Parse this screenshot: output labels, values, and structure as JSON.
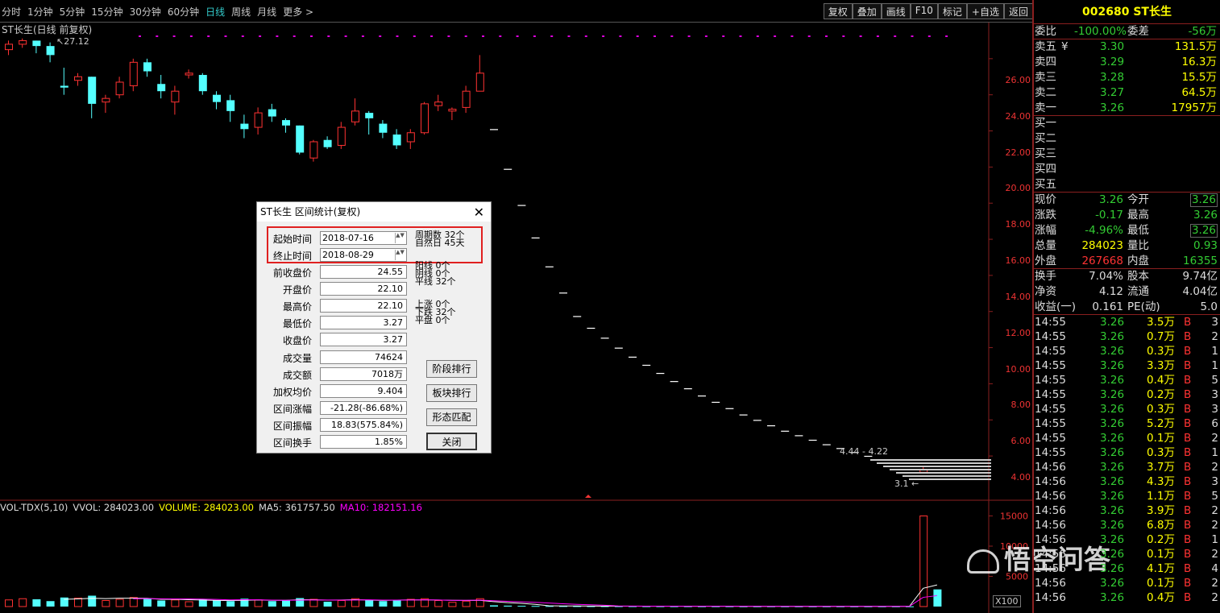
{
  "toolbar": {
    "periods": [
      "分时",
      "1分钟",
      "5分钟",
      "15分钟",
      "30分钟",
      "60分钟",
      "日线",
      "周线",
      "月线",
      "更多 >"
    ],
    "active_period": "日线",
    "tools": [
      "复权",
      "叠加",
      "画线",
      "F10",
      "标记",
      "+自选",
      "返回"
    ]
  },
  "chart": {
    "title": "ST长生(日线 前复权)",
    "peak_label": "27.12",
    "y_labels": [
      "26.00",
      "24.00",
      "22.00",
      "20.00",
      "18.00",
      "16.00",
      "14.00",
      "12.00",
      "10.00",
      "8.00",
      "6.00",
      "4.00"
    ],
    "vol_y_labels": [
      "15000",
      "10000",
      "5000"
    ],
    "range_label": "4.44 - 4.22",
    "low_label": "3.1",
    "x100": "X100",
    "vol_header": {
      "name": "VOL-TDX(5,10)",
      "vvol": "VVOL: 284023.00",
      "volume": "VOLUME: 284023.00",
      "ma5": "MA5: 361757.50",
      "ma10": "MA10: 182151.16"
    },
    "colors": {
      "up": "#ff3232",
      "down": "#54ffff",
      "ma10": "#ff00ff"
    }
  },
  "chart_data": {
    "type": "candlestick",
    "title": "ST长生(日线 前复权)",
    "ylim": [
      2.8,
      28
    ],
    "candles": [
      {
        "o": 26.5,
        "c": 26.8,
        "h": 27.0,
        "l": 26.2
      },
      {
        "o": 26.8,
        "c": 27.0,
        "h": 27.12,
        "l": 26.6
      },
      {
        "o": 27.0,
        "c": 26.7,
        "h": 27.0,
        "l": 26.3
      },
      {
        "o": 26.7,
        "c": 26.2,
        "h": 26.9,
        "l": 25.8
      },
      {
        "o": 24.5,
        "c": 24.4,
        "h": 25.5,
        "l": 24.0
      },
      {
        "o": 24.8,
        "c": 25.0,
        "h": 25.2,
        "l": 24.5
      },
      {
        "o": 25.0,
        "c": 23.5,
        "h": 25.0,
        "l": 22.7
      },
      {
        "o": 23.6,
        "c": 23.8,
        "h": 24.0,
        "l": 23.0
      },
      {
        "o": 24.0,
        "c": 24.7,
        "h": 25.0,
        "l": 23.8
      },
      {
        "o": 24.5,
        "c": 25.8,
        "h": 26.0,
        "l": 24.2
      },
      {
        "o": 25.8,
        "c": 25.3,
        "h": 26.0,
        "l": 25.0
      },
      {
        "o": 24.6,
        "c": 24.2,
        "h": 25.1,
        "l": 23.8
      },
      {
        "o": 23.6,
        "c": 24.2,
        "h": 24.5,
        "l": 22.9
      },
      {
        "o": 25.1,
        "c": 25.2,
        "h": 25.4,
        "l": 24.9
      },
      {
        "o": 25.1,
        "c": 24.2,
        "h": 25.2,
        "l": 24.0
      },
      {
        "o": 24.0,
        "c": 23.6,
        "h": 24.2,
        "l": 23.2
      },
      {
        "o": 23.7,
        "c": 23.1,
        "h": 24.0,
        "l": 22.5
      },
      {
        "o": 22.4,
        "c": 22.1,
        "h": 22.9,
        "l": 21.6
      },
      {
        "o": 22.2,
        "c": 23.0,
        "h": 23.3,
        "l": 21.8
      },
      {
        "o": 23.2,
        "c": 22.8,
        "h": 23.5,
        "l": 22.5
      },
      {
        "o": 22.6,
        "c": 22.3,
        "h": 22.7,
        "l": 21.9
      },
      {
        "o": 22.3,
        "c": 20.8,
        "h": 22.3,
        "l": 20.7
      },
      {
        "o": 20.5,
        "c": 21.4,
        "h": 21.5,
        "l": 20.3
      },
      {
        "o": 21.5,
        "c": 21.1,
        "h": 21.7,
        "l": 21.0
      },
      {
        "o": 21.2,
        "c": 22.2,
        "h": 22.5,
        "l": 21.0
      },
      {
        "o": 22.5,
        "c": 23.1,
        "h": 23.8,
        "l": 22.3
      },
      {
        "o": 23.0,
        "c": 22.7,
        "h": 23.1,
        "l": 21.8
      },
      {
        "o": 22.4,
        "c": 21.9,
        "h": 22.6,
        "l": 21.6
      },
      {
        "o": 21.8,
        "c": 21.2,
        "h": 22.1,
        "l": 21.0
      },
      {
        "o": 21.4,
        "c": 21.9,
        "h": 22.1,
        "l": 21.0
      },
      {
        "o": 21.9,
        "c": 23.5,
        "h": 23.6,
        "l": 21.8
      },
      {
        "o": 23.4,
        "c": 23.6,
        "h": 24.0,
        "l": 23.1
      },
      {
        "o": 23.1,
        "c": 23.2,
        "h": 23.3,
        "l": 22.6
      },
      {
        "o": 23.3,
        "c": 24.2,
        "h": 24.5,
        "l": 23.0
      },
      {
        "o": 24.2,
        "c": 25.2,
        "h": 26.2,
        "l": 24.2
      },
      {
        "o": 22.1,
        "c": 22.1,
        "h": 22.1,
        "l": 22.1
      },
      {
        "o": 19.9,
        "c": 19.9,
        "h": 19.9,
        "l": 19.9
      },
      {
        "o": 17.9,
        "c": 17.9,
        "h": 17.9,
        "l": 17.9
      },
      {
        "o": 16.1,
        "c": 16.1,
        "h": 16.1,
        "l": 16.1
      },
      {
        "o": 14.5,
        "c": 14.5,
        "h": 14.5,
        "l": 14.5
      },
      {
        "o": 13.05,
        "c": 13.05,
        "h": 13.05,
        "l": 13.05
      },
      {
        "o": 11.75,
        "c": 11.75,
        "h": 11.75,
        "l": 11.75
      },
      {
        "o": 11.1,
        "c": 11.1,
        "h": 11.1,
        "l": 11.1
      },
      {
        "o": 10.55,
        "c": 10.55,
        "h": 10.55,
        "l": 10.55
      },
      {
        "o": 10.0,
        "c": 10.0,
        "h": 10.0,
        "l": 10.0
      },
      {
        "o": 9.5,
        "c": 9.5,
        "h": 9.5,
        "l": 9.5
      },
      {
        "o": 9.05,
        "c": 9.05,
        "h": 9.05,
        "l": 9.05
      },
      {
        "o": 8.6,
        "c": 8.6,
        "h": 8.6,
        "l": 8.6
      },
      {
        "o": 8.15,
        "c": 8.15,
        "h": 8.15,
        "l": 8.15
      },
      {
        "o": 7.75,
        "c": 7.75,
        "h": 7.75,
        "l": 7.75
      },
      {
        "o": 7.35,
        "c": 7.35,
        "h": 7.35,
        "l": 7.35
      },
      {
        "o": 7.0,
        "c": 7.0,
        "h": 7.0,
        "l": 7.0
      },
      {
        "o": 6.65,
        "c": 6.65,
        "h": 6.65,
        "l": 6.65
      },
      {
        "o": 6.3,
        "c": 6.3,
        "h": 6.3,
        "l": 6.3
      },
      {
        "o": 6.0,
        "c": 6.0,
        "h": 6.0,
        "l": 6.0
      },
      {
        "o": 5.7,
        "c": 5.7,
        "h": 5.7,
        "l": 5.7
      },
      {
        "o": 5.4,
        "c": 5.4,
        "h": 5.4,
        "l": 5.4
      },
      {
        "o": 5.15,
        "c": 5.15,
        "h": 5.15,
        "l": 5.15
      },
      {
        "o": 4.9,
        "c": 4.9,
        "h": 4.9,
        "l": 4.9
      },
      {
        "o": 4.65,
        "c": 4.65,
        "h": 4.65,
        "l": 4.65
      },
      {
        "o": 4.44,
        "c": 4.44,
        "h": 4.44,
        "l": 4.44
      },
      {
        "o": 4.22,
        "c": 4.22,
        "h": 4.22,
        "l": 4.22
      },
      {
        "o": 4.01,
        "c": 4.01,
        "h": 4.01,
        "l": 4.01
      },
      {
        "o": 3.81,
        "c": 3.81,
        "h": 3.81,
        "l": 3.81
      },
      {
        "o": 3.62,
        "c": 3.62,
        "h": 3.62,
        "l": 3.62
      },
      {
        "o": 3.44,
        "c": 3.44,
        "h": 3.44,
        "l": 3.44
      },
      {
        "o": 3.1,
        "c": 3.27,
        "h": 3.4,
        "l": 3.1
      },
      {
        "o": 3.27,
        "c": 3.26,
        "h": 3.28,
        "l": 3.25
      }
    ],
    "volumes": [
      1100,
      1300,
      1200,
      900,
      1500,
      1400,
      1800,
      1000,
      1200,
      1500,
      1300,
      1000,
      1100,
      800,
      1200,
      1000,
      900,
      1300,
      1100,
      900,
      1000,
      1400,
      1200,
      800,
      1000,
      1300,
      1100,
      900,
      1000,
      1200,
      1300,
      1000,
      700,
      900,
      1300,
      200,
      150,
      120,
      100,
      90,
      80,
      70,
      60,
      60,
      55,
      55,
      50,
      50,
      45,
      45,
      40,
      40,
      40,
      35,
      35,
      35,
      30,
      30,
      30,
      30,
      30,
      30,
      30,
      30,
      30,
      30,
      15000,
      2840
    ]
  },
  "quote": {
    "code": "002680",
    "name": "ST长生",
    "weibi_label": "委比",
    "weibi": "-100.00%",
    "weicha_label": "委差",
    "weicha": "-56万",
    "sells": [
      {
        "label": "卖五",
        "mark": "¥",
        "price": "3.30",
        "vol": "131.5万"
      },
      {
        "label": "卖四",
        "mark": "",
        "price": "3.29",
        "vol": "16.3万"
      },
      {
        "label": "卖三",
        "mark": "",
        "price": "3.28",
        "vol": "15.5万"
      },
      {
        "label": "卖二",
        "mark": "",
        "price": "3.27",
        "vol": "64.5万"
      },
      {
        "label": "卖一",
        "mark": "",
        "price": "3.26",
        "vol": "17957万"
      }
    ],
    "buys": [
      "买一",
      "买二",
      "买三",
      "买四",
      "买五"
    ],
    "stats": [
      {
        "l1": "现价",
        "v1": "3.26",
        "c1": "g",
        "l2": "今开",
        "v2": "3.26",
        "c2": "g",
        "box2": true
      },
      {
        "l1": "涨跌",
        "v1": "-0.17",
        "c1": "g",
        "l2": "最高",
        "v2": "3.26",
        "c2": "g",
        "box2": false
      },
      {
        "l1": "涨幅",
        "v1": "-4.96%",
        "c1": "g",
        "l2": "最低",
        "v2": "3.26",
        "c2": "g",
        "box2": true
      },
      {
        "l1": "总量",
        "v1": "284023",
        "c1": "y",
        "l2": "量比",
        "v2": "0.93",
        "c2": "g",
        "box2": false
      },
      {
        "l1": "外盘",
        "v1": "267668",
        "c1": "r",
        "l2": "内盘",
        "v2": "16355",
        "c2": "g",
        "box2": false
      }
    ],
    "stats2": [
      {
        "l1": "换手",
        "v1": "7.04%",
        "l2": "股本",
        "v2": "9.74亿"
      },
      {
        "l1": "净资",
        "v1": "4.12",
        "l2": "流通",
        "v2": "4.04亿"
      },
      {
        "l1": "收益(一)",
        "v1": "0.161",
        "l2": "PE(动)",
        "v2": "5.0"
      }
    ],
    "ticks": [
      {
        "t": "14:55",
        "p": "3.26",
        "v": "3.5万",
        "bs": "B",
        "n": "3"
      },
      {
        "t": "14:55",
        "p": "3.26",
        "v": "0.7万",
        "bs": "B",
        "n": "2"
      },
      {
        "t": "14:55",
        "p": "3.26",
        "v": "0.3万",
        "bs": "B",
        "n": "1"
      },
      {
        "t": "14:55",
        "p": "3.26",
        "v": "3.3万",
        "bs": "B",
        "n": "1"
      },
      {
        "t": "14:55",
        "p": "3.26",
        "v": "0.4万",
        "bs": "B",
        "n": "5"
      },
      {
        "t": "14:55",
        "p": "3.26",
        "v": "0.2万",
        "bs": "B",
        "n": "3"
      },
      {
        "t": "14:55",
        "p": "3.26",
        "v": "0.3万",
        "bs": "B",
        "n": "3"
      },
      {
        "t": "14:55",
        "p": "3.26",
        "v": "5.2万",
        "bs": "B",
        "n": "6"
      },
      {
        "t": "14:55",
        "p": "3.26",
        "v": "0.1万",
        "bs": "B",
        "n": "2"
      },
      {
        "t": "14:55",
        "p": "3.26",
        "v": "0.3万",
        "bs": "B",
        "n": "1"
      },
      {
        "t": "14:56",
        "p": "3.26",
        "v": "3.7万",
        "bs": "B",
        "n": "2"
      },
      {
        "t": "14:56",
        "p": "3.26",
        "v": "4.3万",
        "bs": "B",
        "n": "3"
      },
      {
        "t": "14:56",
        "p": "3.26",
        "v": "1.1万",
        "bs": "B",
        "n": "5"
      },
      {
        "t": "14:56",
        "p": "3.26",
        "v": "3.9万",
        "bs": "B",
        "n": "2"
      },
      {
        "t": "14:56",
        "p": "3.26",
        "v": "6.8万",
        "bs": "B",
        "n": "2"
      },
      {
        "t": "14:56",
        "p": "3.26",
        "v": "0.2万",
        "bs": "B",
        "n": "1"
      },
      {
        "t": "14:56",
        "p": "3.26",
        "v": "0.1万",
        "bs": "B",
        "n": "2"
      },
      {
        "t": "14:56",
        "p": "3.26",
        "v": "4.1万",
        "bs": "B",
        "n": "4"
      },
      {
        "t": "14:56",
        "p": "3.26",
        "v": "0.1万",
        "bs": "B",
        "n": "2"
      },
      {
        "t": "14:56",
        "p": "3.26",
        "v": "0.4万",
        "bs": "B",
        "n": "2"
      }
    ]
  },
  "dialog": {
    "title": "ST长生 区间统计(复权)",
    "fields": [
      {
        "label": "起始时间",
        "value": "2018-07-16",
        "spin": true
      },
      {
        "label": "终止时间",
        "value": "2018-08-29",
        "spin": true
      },
      {
        "label": "前收盘价",
        "value": "24.55"
      },
      {
        "label": "开盘价",
        "value": "22.10"
      },
      {
        "label": "最高价",
        "value": "22.10"
      },
      {
        "label": "最低价",
        "value": "3.27"
      },
      {
        "label": "收盘价",
        "value": "3.27"
      },
      {
        "label": "成交量",
        "value": "74624"
      },
      {
        "label": "成交额",
        "value": "7018万"
      },
      {
        "label": "加权均价",
        "value": "9.404"
      },
      {
        "label": "区间涨幅",
        "value": "-21.28(-86.68%)"
      },
      {
        "label": "区间振幅",
        "value": "18.83(575.84%)"
      },
      {
        "label": "区间换手",
        "value": "1.85%"
      }
    ],
    "right_stats": [
      "周期数  32个",
      "自然日  45天",
      "阳线  0个",
      "阴线  0个",
      "平线  32个",
      "上涨  0个",
      "下跌  32个",
      "平盘  0个"
    ],
    "buttons": [
      "阶段排行",
      "板块排行",
      "形态匹配",
      "关闭"
    ]
  },
  "watermark": "悟空问答"
}
